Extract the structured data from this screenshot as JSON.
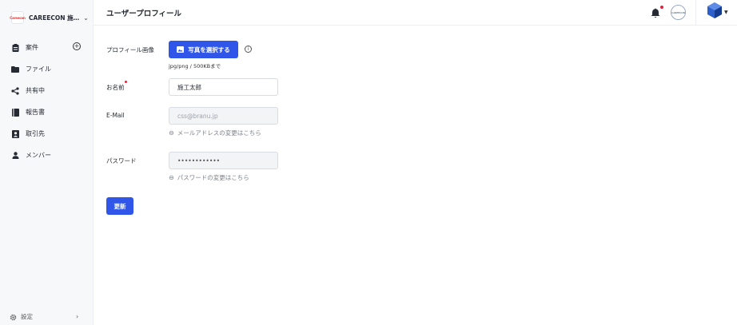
{
  "sidebar": {
    "org": {
      "logo_text": "Careecon",
      "name": "CAREECON 施…"
    },
    "items": [
      {
        "label": "案件",
        "icon": "clipboard-icon"
      },
      {
        "label": "ファイル",
        "icon": "folder-icon"
      },
      {
        "label": "共有中",
        "icon": "share-icon"
      },
      {
        "label": "報告書",
        "icon": "book-icon"
      },
      {
        "label": "取引先",
        "icon": "contact-card-icon"
      },
      {
        "label": "メンバー",
        "icon": "person-icon"
      }
    ],
    "settings_label": "設定"
  },
  "header": {
    "title": "ユーザープロフィール",
    "company_logo_text": "CAREECON"
  },
  "form": {
    "profile_image_label": "プロフィール画像",
    "upload_button_label": "写真を選択する",
    "file_hint": "jpg/png / 500KBまで",
    "name_label": "お名前",
    "name_value": "施工太郎",
    "email_label": "E-Mail",
    "email_value": "css@branu.jp",
    "email_change_link": "メールアドレスの変更はこちら",
    "password_label": "パスワード",
    "password_value": "••••••••••••",
    "password_change_link": "パスワードの変更はこちら",
    "submit_label": "更新"
  },
  "colors": {
    "primary": "#2f56e8",
    "required": "#e0233a",
    "sidebar_bg": "#f7f8fa"
  }
}
